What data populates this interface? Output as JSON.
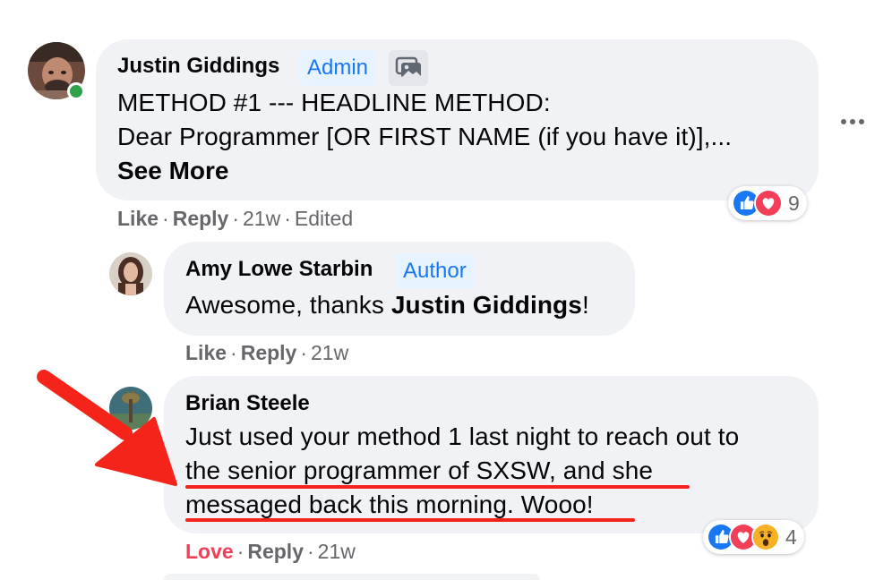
{
  "comments": [
    {
      "author": "Justin Giddings",
      "badge": "Admin",
      "lines": [
        "METHOD #1 --- HEADLINE METHOD:",
        "Dear Programmer [OR FIRST NAME (if you have it)],..."
      ],
      "see_more": "See More",
      "actions": {
        "like": "Like",
        "reply": "Reply",
        "time": "21w",
        "edited": "Edited",
        "sep": "·"
      },
      "reactions": {
        "icons": [
          "like-icon",
          "love-icon"
        ],
        "count": "9"
      },
      "avatar_online": true
    },
    {
      "author": "Amy Lowe Starbin",
      "badge": "Author",
      "text_before": "Awesome, thanks ",
      "mention": "Justin Giddings",
      "text_after": "!",
      "actions": {
        "like": "Like",
        "reply": "Reply",
        "time": "21w",
        "sep": "·"
      }
    },
    {
      "author": "Brian Steele",
      "lines": [
        "Just used your method 1 last night to reach out to",
        "the senior programmer of SXSW, and she",
        "messaged back this morning. Wooo!"
      ],
      "actions": {
        "like": "Love",
        "reply": "Reply",
        "time": "21w",
        "sep": "·"
      },
      "reactions": {
        "icons": [
          "like-icon",
          "love-icon",
          "wow-icon"
        ],
        "count": "4"
      }
    }
  ],
  "colors": {
    "bubble": "#f0f2f5",
    "badge_bg": "#e7f3ff",
    "badge_text": "#1877f2",
    "meta_text": "#65676b",
    "love": "#f33e58",
    "online": "#31a24c",
    "annotation": "#f5241a"
  },
  "icons": {
    "more": "more-horizontal-icon",
    "media": "photo-attachment-icon"
  }
}
